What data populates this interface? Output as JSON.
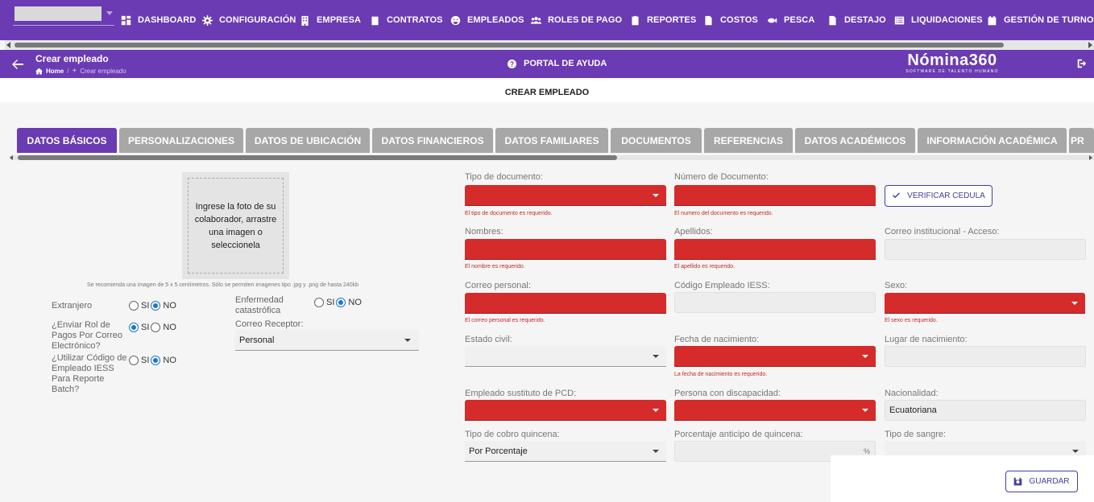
{
  "nav": {
    "items": [
      {
        "label": "DASHBOARD",
        "icon": "dashboard-icon"
      },
      {
        "label": "CONFIGURACIÓN",
        "icon": "gear-icon"
      },
      {
        "label": "EMPRESA",
        "icon": "building-icon"
      },
      {
        "label": "CONTRATOS",
        "icon": "contract-icon"
      },
      {
        "label": "EMPLEADOS",
        "icon": "employees-icon"
      },
      {
        "label": "ROLES DE PAGO",
        "icon": "people-icon"
      },
      {
        "label": "REPORTES",
        "icon": "report-icon"
      },
      {
        "label": "COSTOS",
        "icon": "file-icon"
      },
      {
        "label": "PESCA",
        "icon": "fish-icon"
      },
      {
        "label": "DESTAJO",
        "icon": "document-icon"
      },
      {
        "label": "LIQUIDACIONES",
        "icon": "list-icon"
      },
      {
        "label": "GESTIÓN DE TURNOS",
        "icon": "calendar-icon"
      }
    ]
  },
  "header": {
    "title": "Crear empleado",
    "breadcrumb_home": "Home",
    "breadcrumb_sep": "/",
    "breadcrumb_current": "Crear empleado",
    "help": "PORTAL DE AYUDA",
    "logo": "Nómina360",
    "logo_sub": "SOFTWARE DE TALENTO HUMANO"
  },
  "section_title": "CREAR EMPLEADO",
  "tabs": [
    {
      "label": "DATOS BÁSICOS",
      "active": true
    },
    {
      "label": "PERSONALIZACIONES",
      "active": false
    },
    {
      "label": "DATOS DE UBICACIÓN",
      "active": false
    },
    {
      "label": "DATOS FINANCIEROS",
      "active": false
    },
    {
      "label": "DATOS FAMILIARES",
      "active": false
    },
    {
      "label": "DOCUMENTOS",
      "active": false
    },
    {
      "label": "REFERENCIAS",
      "active": false
    },
    {
      "label": "DATOS ACADÉMICOS",
      "active": false
    },
    {
      "label": "INFORMACIÓN ACADÉMICA",
      "active": false
    },
    {
      "label": "PR",
      "active": false
    }
  ],
  "photo": {
    "prompt": "Ingrese la foto de su colaborador, arrastre una imagen o seleccionela",
    "note": "Se recomienda una imagen de 5 x 5 centímetros. Sólo se permiten imagenes tipo .jpg y .png de hasta 240kb"
  },
  "options": {
    "yes": "SI",
    "no": "NO",
    "extranjero": {
      "label": "Extranjero",
      "value": "NO"
    },
    "enviar_rol": {
      "label": "¿Enviar Rol de Pagos Por Correo Electrónico?",
      "value": "SI"
    },
    "codigo_iess": {
      "label": "¿Utilizar Código de Empleado IESS Para Reporte Batch?",
      "value": "NO"
    },
    "enfermedad": {
      "label": "Enfermedad catastrófica",
      "value": "NO"
    },
    "correo_receptor": {
      "label": "Correo Receptor:",
      "value": "Personal"
    }
  },
  "fields": {
    "tipo_documento": {
      "label": "Tipo de documento:",
      "value": "",
      "error": "El tipo de documento es requerido."
    },
    "numero_documento": {
      "label": "Número de Documento:",
      "value": "",
      "error": "El numero del documento es requerido."
    },
    "verificar": "VERIFICAR CEDULA",
    "nombres": {
      "label": "Nombres:",
      "value": "",
      "error": "El nombre es requerido."
    },
    "apellidos": {
      "label": "Apellidos:",
      "value": "",
      "error": "El apellido es requerido."
    },
    "correo_institucional": {
      "label": "Correo institucional - Acceso:",
      "value": ""
    },
    "correo_personal": {
      "label": "Correo personal:",
      "value": "",
      "error": "El correo personal es requerido."
    },
    "codigo_empleado": {
      "label": "Código Empleado IESS:",
      "value": ""
    },
    "sexo": {
      "label": "Sexo:",
      "value": "",
      "error": "El sexo es requerido."
    },
    "estado_civil": {
      "label": "Estado civil:",
      "value": ""
    },
    "fecha_nacimiento": {
      "label": "Fecha de nacimiento:",
      "value": "",
      "error": "La fecha de nacimiento es requerido."
    },
    "lugar_nacimiento": {
      "label": "Lugar de nacimiento:",
      "value": ""
    },
    "sustituto_pcd": {
      "label": "Empleado sustituto de PCD:",
      "value": ""
    },
    "discapacidad": {
      "label": "Persona con discapacidad:",
      "value": ""
    },
    "nacionalidad": {
      "label": "Nacionalidad:",
      "value": "Ecuatoriana"
    },
    "tipo_cobro": {
      "label": "Tipo de cobro quincena:",
      "value": "Por Porcentaje"
    },
    "porcentaje_anticipo": {
      "label": "Porcentaje anticipo de quincena:",
      "value": "",
      "suffix": "%"
    },
    "tipo_sangre": {
      "label": "Tipo de sangre:",
      "value": ""
    }
  },
  "save": "GUARDAR",
  "colors": {
    "primary": "#6a3bb3",
    "error": "#d62b2b",
    "radio": "#1976d2"
  }
}
